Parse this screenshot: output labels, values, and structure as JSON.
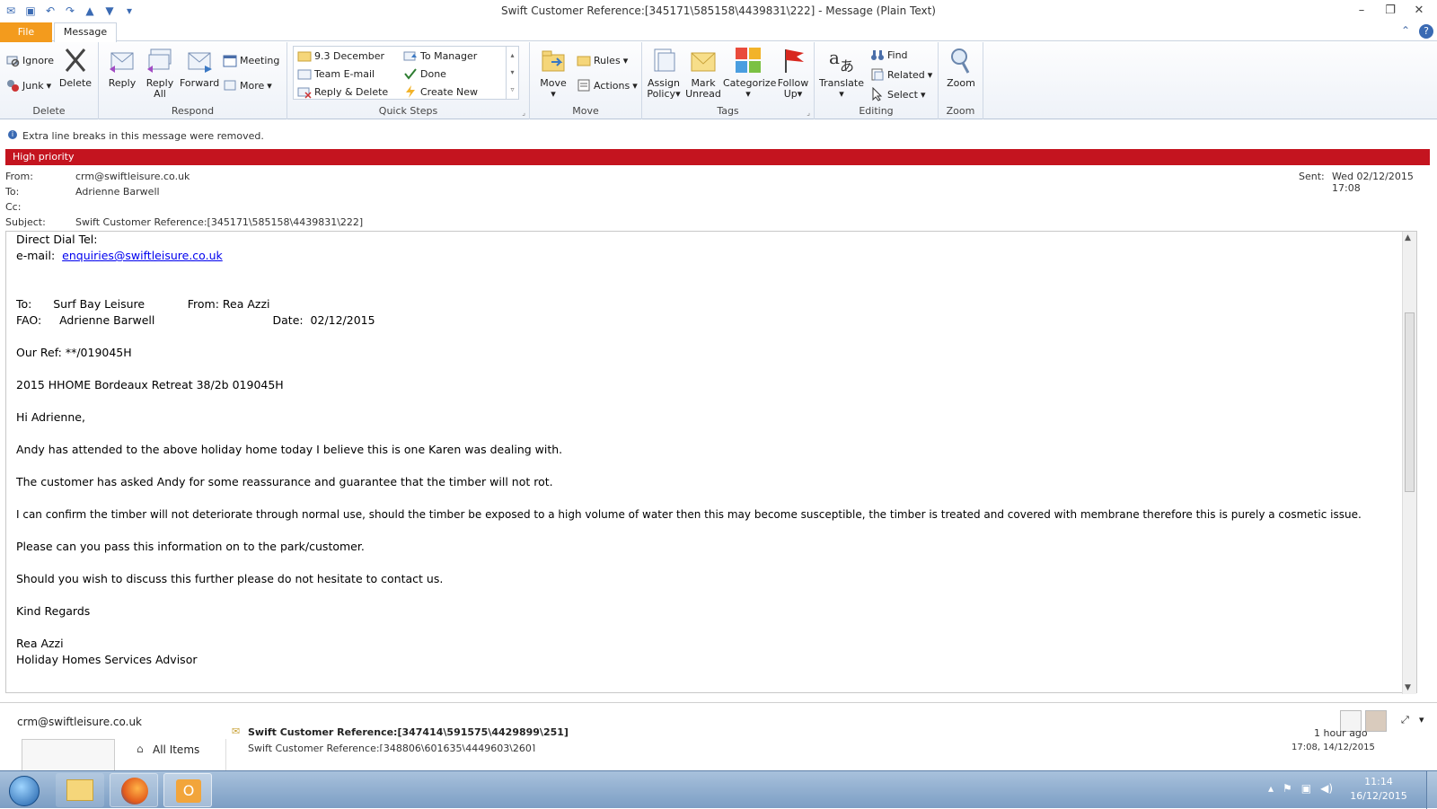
{
  "window": {
    "title": "Swift Customer Reference:[345171\\585158\\4439831\\222]  -  Message (Plain Text)"
  },
  "tabs": {
    "file": "File",
    "message": "Message"
  },
  "ribbon": {
    "delete_group": {
      "label": "Delete",
      "ignore": "Ignore",
      "junk": "Junk",
      "delete": "Delete"
    },
    "respond_group": {
      "label": "Respond",
      "reply": "Reply",
      "reply_all_1": "Reply",
      "reply_all_2": "All",
      "forward": "Forward",
      "meeting": "Meeting",
      "more": "More"
    },
    "quicksteps_group": {
      "label": "Quick Steps",
      "items": [
        "9.3 December",
        "Team E-mail",
        "Reply & Delete",
        "To Manager",
        "Done",
        "Create New"
      ]
    },
    "move_group": {
      "label": "Move",
      "move": "Move",
      "rules": "Rules",
      "actions": "Actions"
    },
    "tags_group": {
      "label": "Tags",
      "assign_1": "Assign",
      "assign_2": "Policy",
      "mark_1": "Mark",
      "mark_2": "Unread",
      "categorize": "Categorize",
      "follow_1": "Follow",
      "follow_2": "Up"
    },
    "editing_group": {
      "label": "Editing",
      "translate": "Translate",
      "find": "Find",
      "related": "Related",
      "select": "Select"
    },
    "zoom_group": {
      "label": "Zoom",
      "zoom": "Zoom"
    }
  },
  "info": {
    "message": "Extra line breaks in this message were removed."
  },
  "priority": {
    "label": "High priority"
  },
  "header": {
    "from_label": "From:",
    "from": "crm@swiftleisure.co.uk",
    "to_label": "To:",
    "to": "Adrienne Barwell",
    "cc_label": "Cc:",
    "subject_label": "Subject:",
    "subject": "Swift Customer Reference:[345171\\585158\\4439831\\222]",
    "sent_label": "Sent:",
    "sent": "Wed 02/12/2015 17:08"
  },
  "body": {
    "line1": "Direct Dial Tel:",
    "email_label": "e-mail:  ",
    "email_link": "enquiries@swiftleisure.co.uk",
    "to_line": "To:      Surf Bay Leisure            From: Rea Azzi",
    "fao_line": "FAO:     Adrienne Barwell                                 Date:  02/12/2015",
    "ref": "Our Ref: **/019045H",
    "home": "2015 HHOME Bordeaux Retreat 38/2b 019045H",
    "greeting": "Hi Adrienne,",
    "p1": "Andy has attended to the above holiday home today I believe this is one Karen was dealing with.",
    "p2": "The customer has asked Andy for some reassurance and guarantee that the timber will not rot.",
    "p3": "I can confirm the timber will not deteriorate through normal use, should the timber be exposed to a high volume of water then this may become susceptible, the timber is treated and covered with membrane therefore this is purely a cosmetic issue.",
    "p4": "Please can you pass this information on to the park/customer.",
    "p5": "Should you wish to discuss this further please do not hesitate to contact us.",
    "closing": "Kind Regards",
    "sig_name": "Rea Azzi",
    "sig_title": "Holiday Homes Services Advisor"
  },
  "people_pane": {
    "contact": "crm@swiftleisure.co.uk",
    "all_items": "All Items",
    "row1_subject": "Swift Customer Reference:[347414\\591575\\4429899\\251]",
    "row1_time": "1 hour ago",
    "row2_subject": "Swift Customer Reference:[348806\\601635\\4449603\\260]",
    "row2_time": "17:08, 14/12/2015"
  },
  "taskbar": {
    "time": "11:14",
    "date": "16/12/2015"
  },
  "colors": {
    "file_tab": "#f39b1d",
    "priority": "#c4141f",
    "link": "#0000ee"
  }
}
